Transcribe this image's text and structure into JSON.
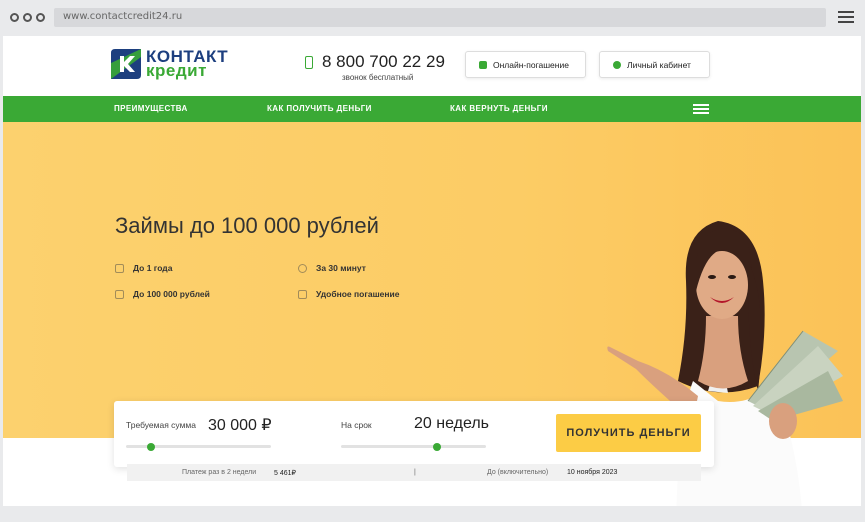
{
  "browser": {
    "url": "www.contactcredit24.ru"
  },
  "header": {
    "logo_line1": "КОНТАКТ",
    "logo_line2": "кредит",
    "phone": "8 800 700 22 29",
    "phone_note": "звонок бесплатный",
    "online_payment_label": "Онлайн-погашение",
    "account_label": "Личный кабинет"
  },
  "nav": {
    "items": [
      {
        "label": "ПРЕИМУЩЕСТВА"
      },
      {
        "label": "КАК ПОЛУЧИТЬ ДЕНЬГИ"
      },
      {
        "label": "КАК ВЕРНУТЬ ДЕНЬГИ"
      }
    ]
  },
  "hero": {
    "title": "Займы до 100 000 рублей",
    "features": [
      {
        "label": "До 1 года",
        "icon": "calendar-icon"
      },
      {
        "label": "За 30 минут",
        "icon": "clock-icon"
      },
      {
        "label": "До 100 000 рублей",
        "icon": "money-icon"
      },
      {
        "label": "Удобное погашение",
        "icon": "wallet-icon"
      }
    ]
  },
  "calculator": {
    "amount_label": "Требуемая сумма",
    "amount_value": "30 000 ₽",
    "amount_position": 0.17,
    "term_label": "На срок",
    "term_value": "20 недель",
    "term_position": 0.66,
    "cta_label": "ПОЛУЧИТЬ ДЕНЬГИ"
  },
  "summary": {
    "payment_label": "Платеж раз в 2 недели",
    "payment_value": "5 461₽",
    "separator": "|",
    "due_label": "До (включительно)",
    "due_value": "10 ноября 2023"
  },
  "colors": {
    "brand_green": "#3aa935",
    "brand_blue": "#1d3f7f",
    "hero_bg": "#fccc65",
    "cta": "#fccc45"
  }
}
